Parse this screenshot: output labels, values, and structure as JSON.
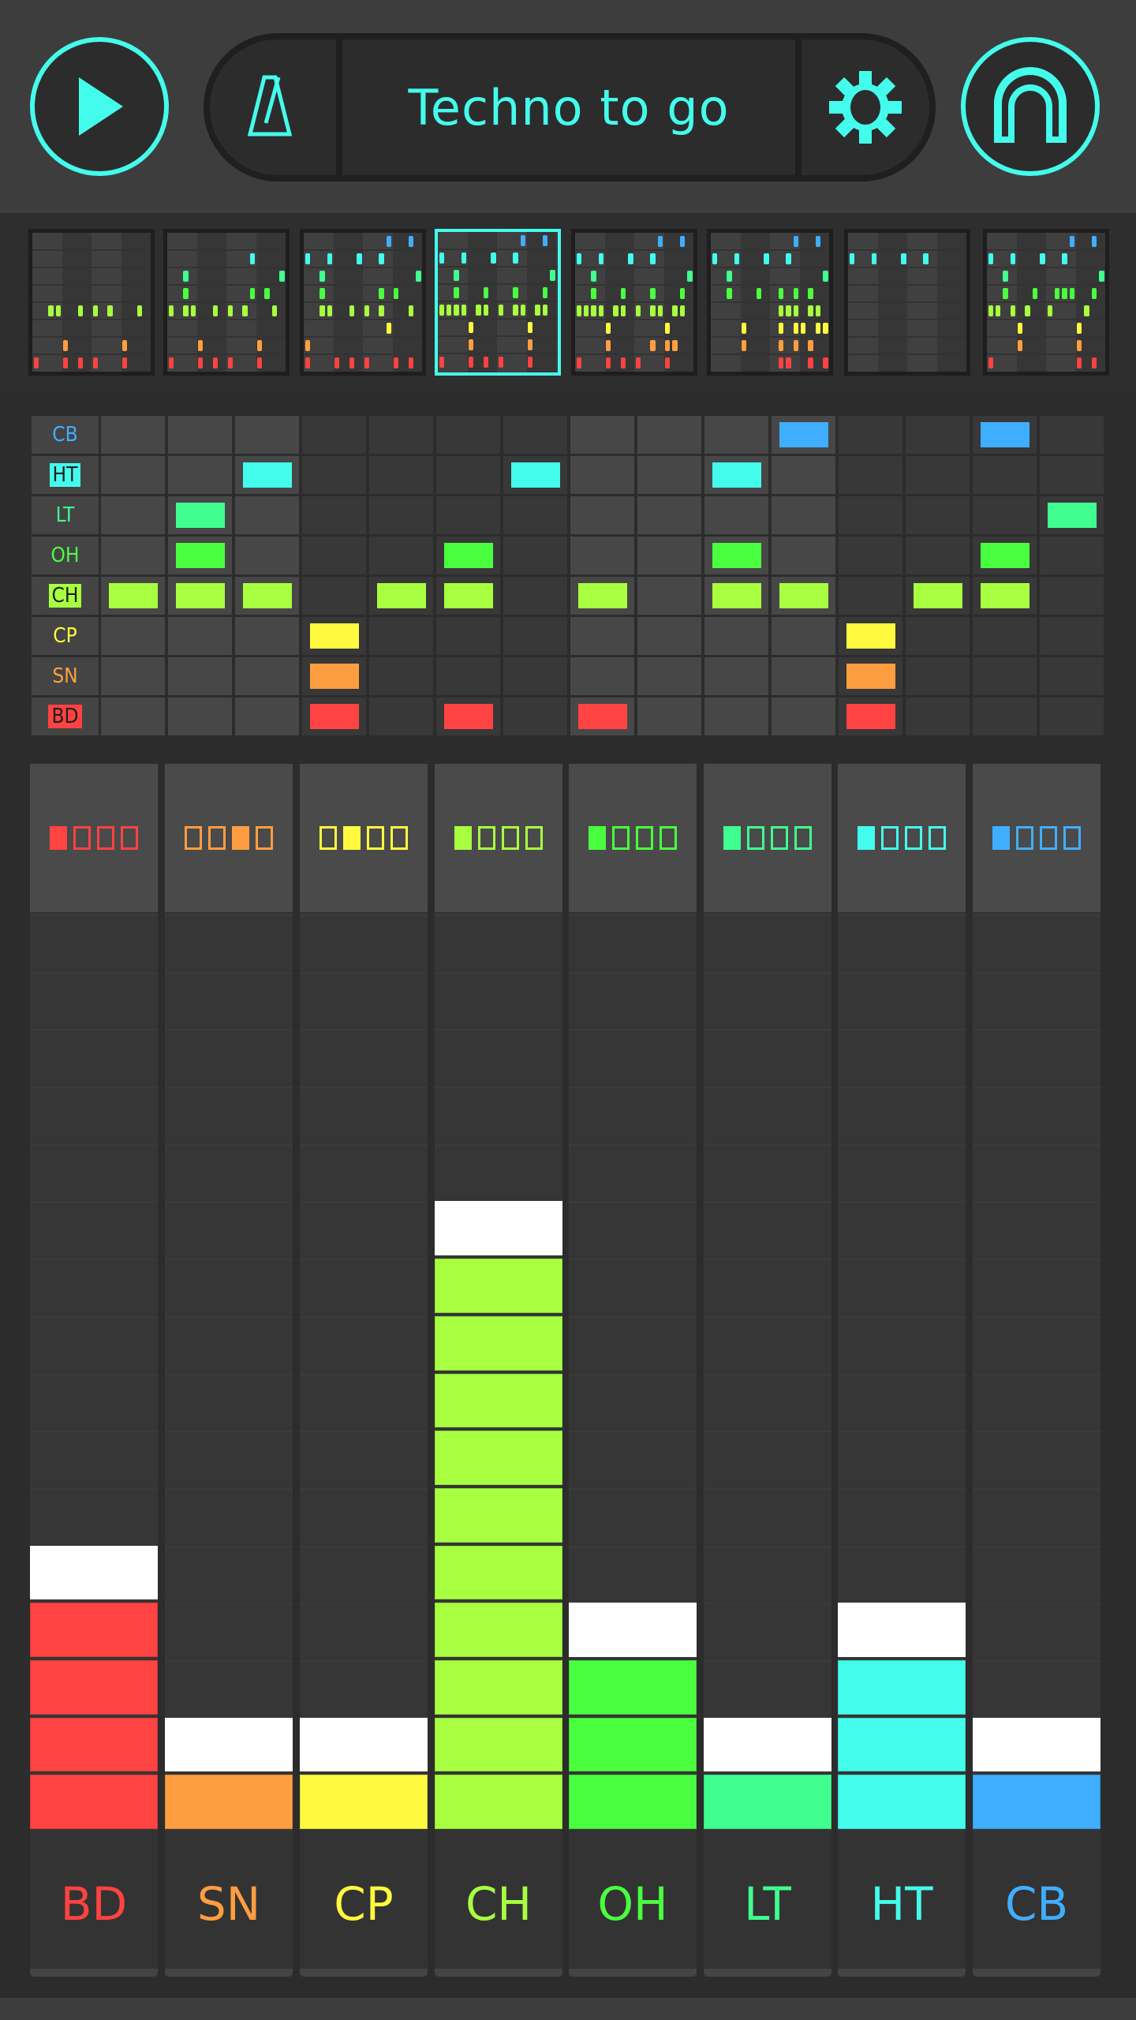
{
  "header": {
    "title": "Techno to go",
    "play_icon": "play-icon",
    "metronome_icon": "metronome-icon",
    "settings_icon": "gear-icon",
    "home_icon": "arch-logo-icon",
    "accent_color": "#44fcec"
  },
  "instruments": [
    {
      "id": "BD",
      "label": "BD",
      "color": "#ff4242"
    },
    {
      "id": "SN",
      "label": "SN",
      "color": "#ff9e40"
    },
    {
      "id": "CP",
      "label": "CP",
      "color": "#fffa40"
    },
    {
      "id": "CH",
      "label": "CH",
      "color": "#a8ff40"
    },
    {
      "id": "OH",
      "label": "OH",
      "color": "#4aff40"
    },
    {
      "id": "LT",
      "label": "LT",
      "color": "#40ff90"
    },
    {
      "id": "HT",
      "label": "HT",
      "color": "#44fcec"
    },
    {
      "id": "CB",
      "label": "CB",
      "color": "#40aeff"
    }
  ],
  "patterns": {
    "selected_index": 3,
    "steps_per_pattern": 16,
    "row_order": [
      "CB",
      "HT",
      "LT",
      "OH",
      "CH",
      "CP",
      "SN",
      "BD"
    ],
    "items": [
      {
        "CB": [],
        "HT": [],
        "LT": [],
        "OH": [],
        "CH": [
          3,
          4,
          7,
          9,
          11,
          15
        ],
        "CP": [],
        "SN": [
          5,
          13
        ],
        "BD": [
          1,
          5,
          7,
          9,
          13
        ]
      },
      {
        "CB": [],
        "HT": [
          12
        ],
        "LT": [
          3,
          16
        ],
        "OH": [
          3,
          12,
          14
        ],
        "CH": [
          1,
          3,
          4,
          7,
          9,
          11,
          15
        ],
        "CP": [],
        "SN": [
          5,
          13
        ],
        "BD": [
          1,
          5,
          7,
          9,
          13
        ]
      },
      {
        "CB": [
          12,
          15
        ],
        "HT": [
          1,
          4,
          8,
          11
        ],
        "LT": [
          3,
          16
        ],
        "OH": [
          3,
          11,
          13
        ],
        "CH": [
          3,
          4,
          7,
          9,
          11,
          15
        ],
        "CP": [
          12
        ],
        "SN": [
          1
        ],
        "BD": [
          1,
          5,
          7,
          9,
          13,
          15
        ]
      },
      {
        "CB": [
          12,
          15
        ],
        "HT": [
          1,
          4,
          8,
          11
        ],
        "LT": [
          3,
          16
        ],
        "OH": [
          3,
          7,
          11,
          15
        ],
        "CH": [
          1,
          2,
          3,
          4,
          6,
          7,
          9,
          11,
          12,
          14,
          15
        ],
        "CP": [
          5,
          13
        ],
        "SN": [
          5,
          13
        ],
        "BD": [
          1,
          5,
          7,
          9,
          13
        ]
      },
      {
        "CB": [
          12,
          15
        ],
        "HT": [
          1,
          4,
          8,
          11
        ],
        "LT": [
          3,
          16
        ],
        "OH": [
          3,
          7,
          11,
          15
        ],
        "CH": [
          1,
          2,
          3,
          4,
          6,
          7,
          9,
          11,
          12,
          14,
          15
        ],
        "CP": [
          5,
          13
        ],
        "SN": [
          5,
          11,
          13,
          14
        ],
        "BD": [
          1,
          5,
          7,
          9,
          13
        ]
      },
      {
        "CB": [
          12,
          15
        ],
        "HT": [
          1,
          4,
          8,
          11
        ],
        "LT": [
          3,
          16
        ],
        "OH": [
          3,
          7,
          10,
          12,
          14
        ],
        "CH": [
          10,
          11,
          12,
          14,
          15
        ],
        "CP": [
          5,
          10,
          12,
          13,
          15,
          16
        ],
        "SN": [
          5,
          10,
          12,
          14
        ],
        "BD": [
          10,
          11,
          14,
          16
        ]
      },
      {
        "CB": [],
        "HT": [
          1,
          4,
          8,
          11
        ],
        "LT": [],
        "OH": [],
        "CH": [],
        "CP": [],
        "SN": [],
        "BD": []
      },
      {
        "CB": [
          12,
          15
        ],
        "HT": [
          1,
          4,
          8,
          11
        ],
        "LT": [
          3,
          16
        ],
        "OH": [
          3,
          7,
          10,
          11,
          12,
          15
        ],
        "CH": [
          1,
          2,
          4,
          6,
          9,
          14
        ],
        "CP": [
          5,
          13
        ],
        "SN": [
          5,
          13
        ],
        "BD": [
          1,
          13,
          15
        ]
      }
    ]
  },
  "step_grid": {
    "visible_steps": [
      2,
      3,
      4,
      5,
      6,
      7,
      8,
      9,
      10,
      11,
      12,
      13,
      14,
      15,
      16
    ],
    "row_order": [
      "CB",
      "HT",
      "LT",
      "OH",
      "CH",
      "CP",
      "SN",
      "BD"
    ],
    "highlighted_labels": [
      "HT",
      "CH",
      "BD"
    ],
    "active_steps": {
      "CB": [
        12,
        15
      ],
      "HT": [
        4,
        8,
        11
      ],
      "LT": [
        3,
        16
      ],
      "OH": [
        3,
        7,
        11,
        15
      ],
      "CH": [
        2,
        3,
        4,
        6,
        7,
        9,
        11,
        12,
        14,
        15
      ],
      "CP": [
        5,
        13
      ],
      "SN": [
        5,
        13
      ],
      "BD": [
        5,
        7,
        9,
        13
      ]
    }
  },
  "mixer": {
    "segments": 16,
    "channels": [
      {
        "id": "BD",
        "label": "BD",
        "level": 5,
        "variation_count": 4,
        "variation_selected": 1
      },
      {
        "id": "SN",
        "label": "SN",
        "level": 2,
        "variation_count": 4,
        "variation_selected": 3
      },
      {
        "id": "CP",
        "label": "CP",
        "level": 2,
        "variation_count": 4,
        "variation_selected": 2
      },
      {
        "id": "CH",
        "label": "CH",
        "level": 11,
        "variation_count": 4,
        "variation_selected": 1
      },
      {
        "id": "OH",
        "label": "OH",
        "level": 4,
        "variation_count": 4,
        "variation_selected": 1
      },
      {
        "id": "LT",
        "label": "LT",
        "level": 2,
        "variation_count": 4,
        "variation_selected": 1
      },
      {
        "id": "HT",
        "label": "HT",
        "level": 4,
        "variation_count": 4,
        "variation_selected": 1
      },
      {
        "id": "CB",
        "label": "CB",
        "level": 2,
        "variation_count": 4,
        "variation_selected": 1
      }
    ]
  }
}
